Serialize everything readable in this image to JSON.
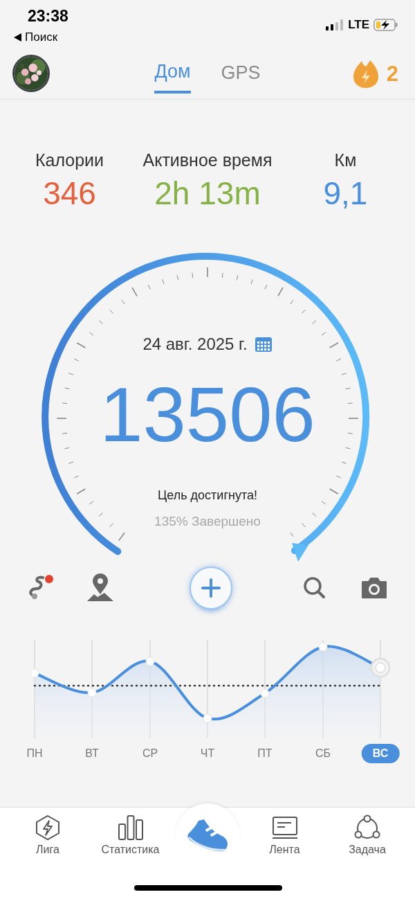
{
  "status_bar": {
    "time": "23:38",
    "back_label": "Поиск",
    "network": "LTE"
  },
  "header": {
    "tabs": [
      {
        "label": "Дом",
        "selected": true
      },
      {
        "label": "GPS",
        "selected": false
      }
    ],
    "streak": "2"
  },
  "stats": [
    {
      "label": "Калории",
      "value": "346",
      "color": "#e2623e"
    },
    {
      "label": "Активное время",
      "value": "2h 13m",
      "color": "#86b146"
    },
    {
      "label": "Км",
      "value": "9,1",
      "color": "#4a8fdc"
    }
  ],
  "gauge": {
    "date": "24 авг. 2025 г.",
    "steps": "13506",
    "message": "Цель достигнута!",
    "progress": "135% Завершено"
  },
  "week": [
    {
      "label": "ПН",
      "selected": false
    },
    {
      "label": "ВТ",
      "selected": false
    },
    {
      "label": "СР",
      "selected": false
    },
    {
      "label": "ЧТ",
      "selected": false
    },
    {
      "label": "ПТ",
      "selected": false
    },
    {
      "label": "СБ",
      "selected": false
    },
    {
      "label": "ВС",
      "selected": true
    }
  ],
  "nav": [
    {
      "label": "Лига"
    },
    {
      "label": "Статистика"
    },
    {
      "label": "Лента"
    },
    {
      "label": "Задача"
    }
  ]
}
